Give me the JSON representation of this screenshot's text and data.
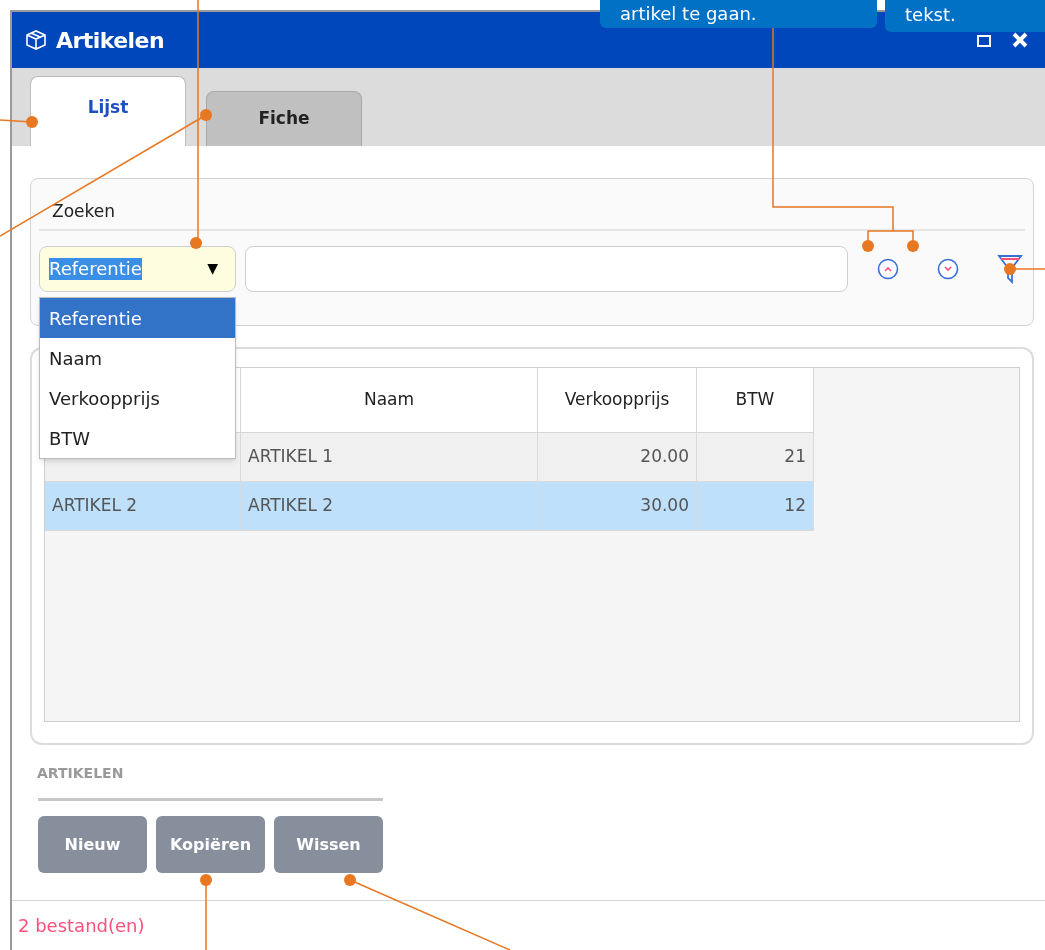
{
  "callouts": [
    {
      "text": "artikel te gaan."
    },
    {
      "text": "tekst."
    }
  ],
  "window": {
    "title": "Artikelen"
  },
  "tabs": [
    {
      "label": "Lijst",
      "selected": true
    },
    {
      "label": "Fiche",
      "selected": false
    }
  ],
  "search": {
    "label": "Zoeken",
    "select": {
      "value": "Referentie",
      "arrow": "▼",
      "expanded": true,
      "options": [
        {
          "label": "Referentie",
          "selected": true
        },
        {
          "label": "Naam",
          "selected": false
        },
        {
          "label": "Verkoopprijs",
          "selected": false
        },
        {
          "label": "BTW",
          "selected": false
        }
      ]
    }
  },
  "table": {
    "columns": [
      "Naam",
      "Verkoopprijs",
      "BTW"
    ],
    "rows": [
      {
        "cells": [
          "",
          "ARTIKEL 1",
          "20.00",
          "21"
        ],
        "selected": false
      },
      {
        "cells": [
          "ARTIKEL 2",
          "ARTIKEL 2",
          "30.00",
          "12"
        ],
        "selected": true
      }
    ]
  },
  "section": {
    "title": "ARTIKELEN",
    "buttons": [
      "Nieuw",
      "Kopiëren",
      "Wissen"
    ]
  },
  "status_bar": {
    "text": "2 bestand(en)"
  }
}
